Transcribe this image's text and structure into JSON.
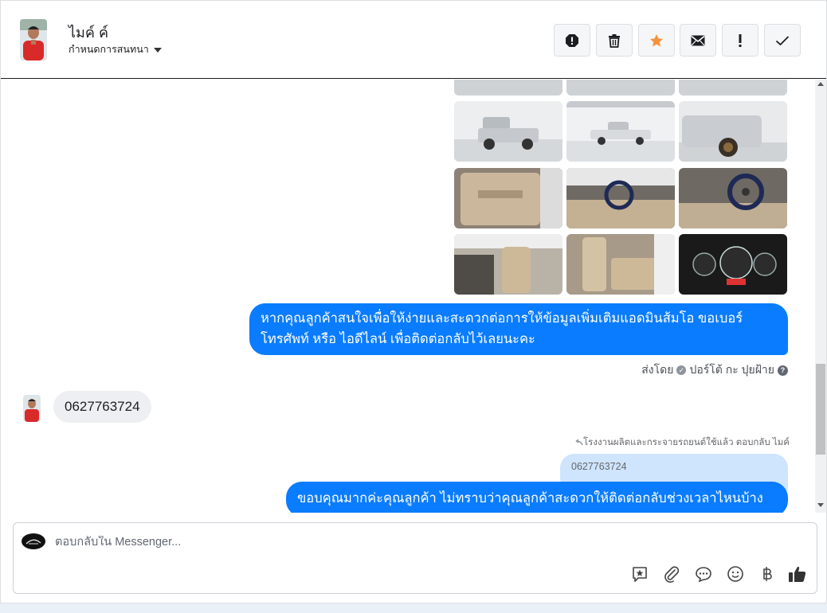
{
  "header": {
    "contact_name": "ไมค์ ค์",
    "conversation_settings": "กำหนดการสนทนา",
    "toolbar": [
      {
        "name": "spam",
        "icon": "alert-octagon-icon"
      },
      {
        "name": "delete",
        "icon": "trash-icon"
      },
      {
        "name": "star",
        "icon": "star-icon",
        "color": "#f7923b"
      },
      {
        "name": "mark-unread",
        "icon": "envelope-icon"
      },
      {
        "name": "important",
        "icon": "exclamation-icon"
      },
      {
        "name": "done",
        "icon": "check-icon"
      }
    ]
  },
  "thread": {
    "messages": [
      {
        "direction": "out",
        "text": "หากคุณลูกค้าสนใจเพื่อให้ง่ายและสะดวกต่อการให้ข้อมูลเพิ่มเติมแอดมินส้มโอ ขอเบอร์โทรศัพท์ หรือ ไอดีไลน์ เพื่อติดต่อกลับไว้เลยนะคะ"
      },
      {
        "direction": "in",
        "text": "0627763724"
      },
      {
        "direction": "out",
        "text": "ขอบคุณมากค่ะคุณลูกค้า ไม่ทราบว่าคุณลูกค้าสะดวกให้ติดต่อกลับช่วงเวลาไหนบ้างคะ"
      }
    ],
    "sent_by": "ส่งโดย",
    "sender_name": "ปอร์โต้ กะ ปุยฝ้าย",
    "reply_note": "โรงงานผลิตและกระจายรถยนต์ใช้แล้ว ตอบกลับ ไมค์",
    "quoted_text": "0627763724"
  },
  "composer": {
    "placeholder": "ตอบกลับใน Messenger...",
    "icons": [
      "saved-reply-icon",
      "attachment-icon",
      "chat-bubble-icon",
      "emoji-icon",
      "baht-icon",
      "thumbs-up-icon"
    ]
  },
  "colors": {
    "accent": "#0a7cff",
    "incoming_bubble": "#eeeff2",
    "quoted_bubble": "#cfe4fd"
  }
}
